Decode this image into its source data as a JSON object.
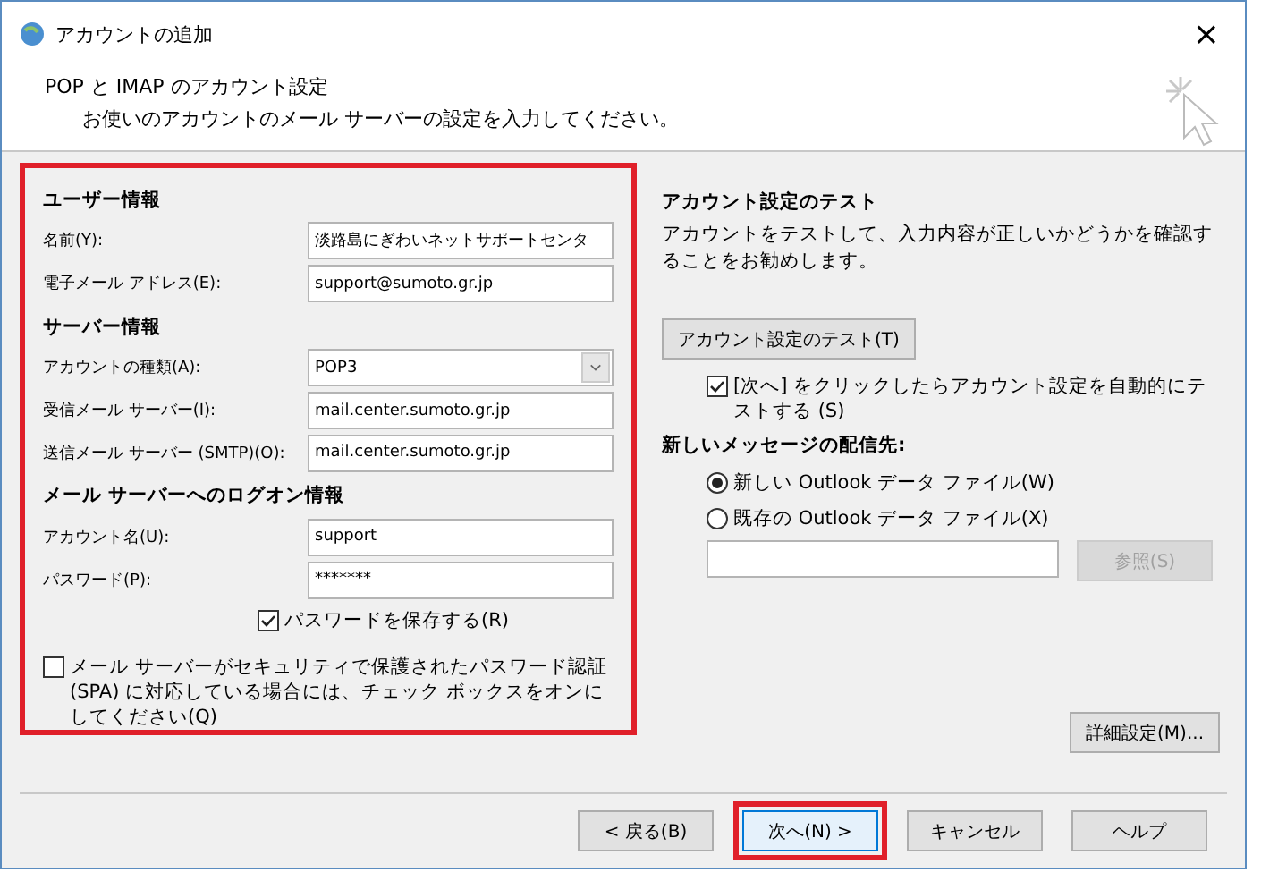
{
  "window": {
    "title": "アカウントの追加",
    "close": "×"
  },
  "header": {
    "title": "POP と IMAP のアカウント設定",
    "subtitle": "お使いのアカウントのメール サーバーの設定を入力してください。"
  },
  "left_panel": {
    "highlighted": true,
    "sections": [
      {
        "heading": "ユーザー情報",
        "fields": [
          {
            "kind": "text",
            "label": "名前(Y):",
            "value": "淡路島にぎわいネットサポートセンタ"
          },
          {
            "kind": "text",
            "label": "電子メール アドレス(E):",
            "value": "support@sumoto.gr.jp"
          }
        ]
      },
      {
        "heading": "サーバー情報",
        "fields": [
          {
            "kind": "select",
            "label": "アカウントの種類(A):",
            "value": "POP3"
          },
          {
            "kind": "text",
            "label": "受信メール サーバー(I):",
            "value": "mail.center.sumoto.gr.jp"
          },
          {
            "kind": "text",
            "label": "送信メール サーバー (SMTP)(O):",
            "value": "mail.center.sumoto.gr.jp"
          }
        ]
      },
      {
        "heading": "メール サーバーへのログオン情報",
        "fields": [
          {
            "kind": "text",
            "label": "アカウント名(U):",
            "value": "support"
          },
          {
            "kind": "text",
            "label": "パスワード(P):",
            "value": "*******"
          }
        ]
      }
    ],
    "remember_password": {
      "label": "パスワードを保存する(R)",
      "checked": true
    },
    "spa": {
      "label": "メール サーバーがセキュリティで保護されたパスワード認証 (SPA) に対応している場合には、チェック ボックスをオンにしてください(Q)",
      "checked": false
    }
  },
  "right_panel": {
    "heading": "アカウント設定のテスト",
    "description": "アカウントをテストして、入力内容が正しいかどうかを確認することをお勧めします。",
    "test_button": "アカウント設定のテスト(T)",
    "auto_test": {
      "label": "[次へ] をクリックしたらアカウント設定を自動的にテストする (S)",
      "checked": true
    },
    "delivery_heading": "新しいメッセージの配信先:",
    "delivery_options": [
      {
        "label": "新しい Outlook データ ファイル(W)",
        "selected": true
      },
      {
        "label": "既存の Outlook データ ファイル(X)",
        "selected": false
      }
    ],
    "browse_button": {
      "label": "参照(S)",
      "disabled": true
    },
    "more_settings": "詳細設定(M)..."
  },
  "buttons": [
    {
      "label": "< 戻る(B)",
      "highlighted": false,
      "focused": false
    },
    {
      "label": "次へ(N) >",
      "highlighted": true,
      "focused": true
    },
    {
      "label": "キャンセル",
      "highlighted": false,
      "focused": false
    },
    {
      "label": "ヘルプ",
      "highlighted": false,
      "focused": false
    }
  ]
}
